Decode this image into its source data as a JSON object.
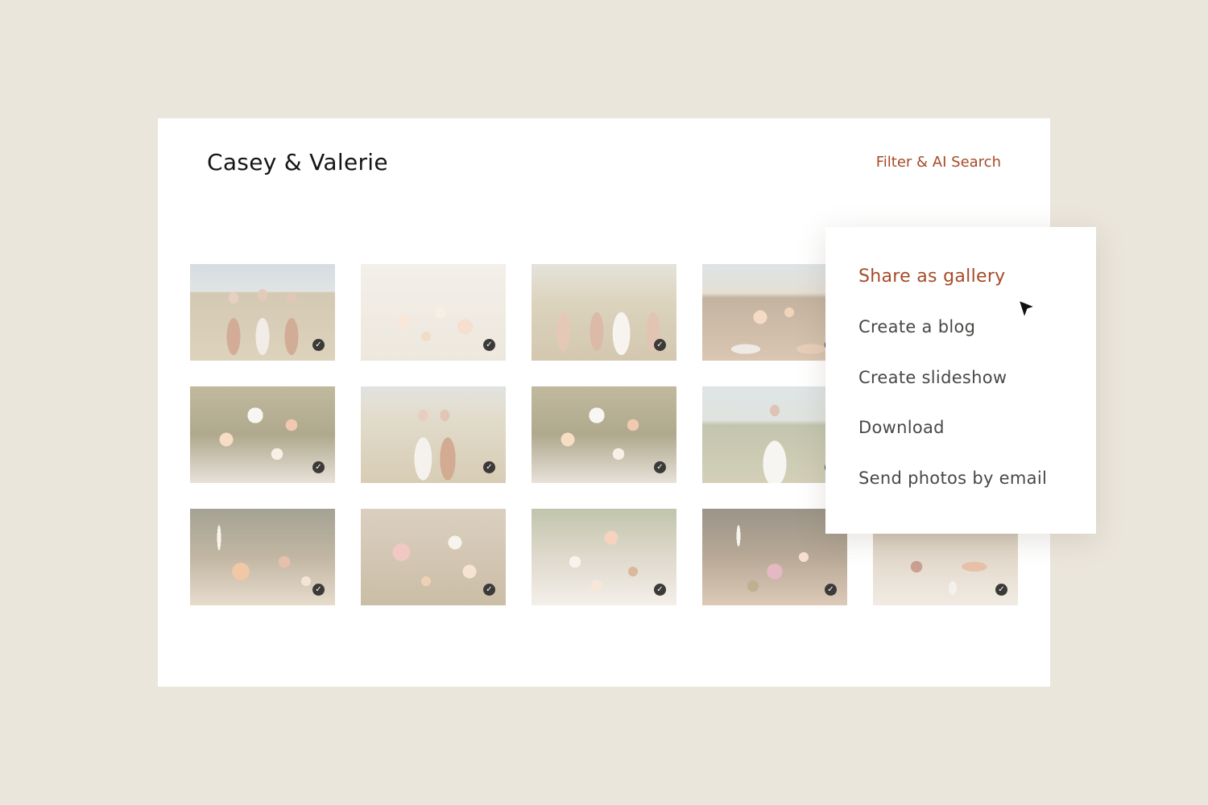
{
  "page": {
    "title": "Casey & Valerie",
    "filter_link": "Filter & AI Search"
  },
  "gallery": {
    "check_icon": "✓",
    "rows": 3,
    "columns": 5,
    "photos": [
      {
        "subject": "bridesmaids-in-field",
        "selected": true
      },
      {
        "subject": "floral-arrangement",
        "selected": true
      },
      {
        "subject": "bridal-party-walking",
        "selected": true
      },
      {
        "subject": "reception-table",
        "selected": true
      },
      {
        "subject": "hidden-by-menu",
        "selected": true
      },
      {
        "subject": "bouquet-on-table",
        "selected": true
      },
      {
        "subject": "bride-and-bridesmaid",
        "selected": true
      },
      {
        "subject": "flower-closeup",
        "selected": true
      },
      {
        "subject": "bride-portrait",
        "selected": true
      },
      {
        "subject": "hidden-by-menu",
        "selected": true
      },
      {
        "subject": "candles-and-flowers",
        "selected": true
      },
      {
        "subject": "dahlia-arrangement",
        "selected": true
      },
      {
        "subject": "centerpiece",
        "selected": true
      },
      {
        "subject": "pink-flowers",
        "selected": true
      },
      {
        "subject": "place-setting",
        "selected": true
      }
    ]
  },
  "menu": {
    "items": [
      {
        "label": "Share as gallery",
        "active": true
      },
      {
        "label": "Create a blog",
        "active": false
      },
      {
        "label": "Create slideshow",
        "active": false
      },
      {
        "label": "Download",
        "active": false
      },
      {
        "label": "Send photos by email",
        "active": false
      }
    ]
  },
  "colors": {
    "background": "#ebe6dc",
    "accent": "#a64a26",
    "menu_text": "#4a4846",
    "check_badge": "#3c3a38"
  },
  "icons": {
    "cursor": "mouse-pointer-icon",
    "check": "check-circle-icon"
  }
}
